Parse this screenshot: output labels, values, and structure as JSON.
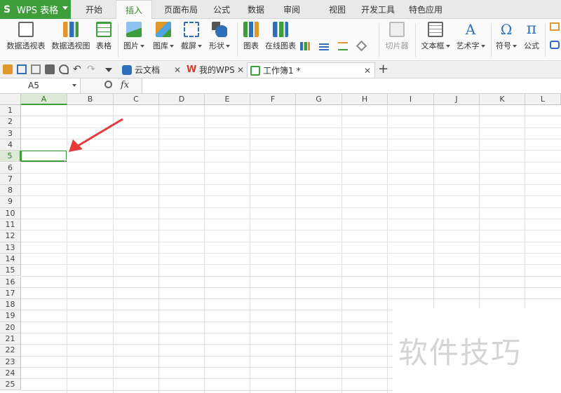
{
  "app": {
    "name": "WPS 表格",
    "logo": "S"
  },
  "menu": {
    "tabs": [
      "开始",
      "插入",
      "页面布局",
      "公式",
      "数据",
      "审阅",
      "视图",
      "开发工具",
      "特色应用"
    ],
    "active": "插入"
  },
  "ribbon": {
    "buttons": [
      {
        "label": "数据透视表",
        "icon": "pivot-table-icon"
      },
      {
        "label": "数据透视图",
        "icon": "pivot-chart-icon"
      },
      {
        "label": "表格",
        "icon": "table-icon"
      },
      {
        "label": "图片",
        "icon": "picture-icon",
        "dropdown": true
      },
      {
        "label": "图库",
        "icon": "gallery-icon",
        "dropdown": true
      },
      {
        "label": "截屏",
        "icon": "screenshot-icon",
        "dropdown": true
      },
      {
        "label": "形状",
        "icon": "shapes-icon",
        "dropdown": true
      },
      {
        "label": "图表",
        "icon": "chart-icon"
      },
      {
        "label": "在线图表",
        "icon": "online-chart-icon"
      },
      {
        "label": "切片器",
        "icon": "slicer-icon",
        "disabled": true
      },
      {
        "label": "文本框",
        "icon": "textbox-icon",
        "dropdown": true
      },
      {
        "label": "艺术字",
        "icon": "wordart-icon",
        "dropdown": true
      },
      {
        "label": "符号",
        "icon": "symbol-icon",
        "dropdown": true
      },
      {
        "label": "公式",
        "icon": "equation-icon"
      }
    ],
    "accent_colors": {
      "green": "#3f9e3c",
      "blue": "#2f6fba",
      "orange": "#e0972c"
    }
  },
  "tabbar": {
    "tabs": [
      {
        "label": "云文档",
        "icon": "cloud-docs-icon"
      },
      {
        "label": "我的WPS",
        "icon": "wps-logo-icon"
      },
      {
        "label": "工作簿1 *",
        "icon": "spreadsheet-file-icon",
        "active": true
      }
    ],
    "new_tab": "+"
  },
  "formula_bar": {
    "cell_ref": "A5",
    "fx": "fx",
    "content": ""
  },
  "sheet": {
    "columns": [
      "A",
      "B",
      "C",
      "D",
      "E",
      "F",
      "G",
      "H",
      "I",
      "J",
      "K",
      "L"
    ],
    "rows": [
      "1",
      "2",
      "3",
      "4",
      "5",
      "6",
      "7",
      "8",
      "9",
      "10",
      "11",
      "12",
      "13",
      "14",
      "15",
      "16",
      "17",
      "18",
      "19",
      "20",
      "21",
      "22",
      "23",
      "24",
      "25"
    ],
    "selected_cell": "A5",
    "selection_color": "#3e9b37",
    "arrow_color": "#e33b3b"
  },
  "watermark": {
    "text": "软件技巧"
  }
}
